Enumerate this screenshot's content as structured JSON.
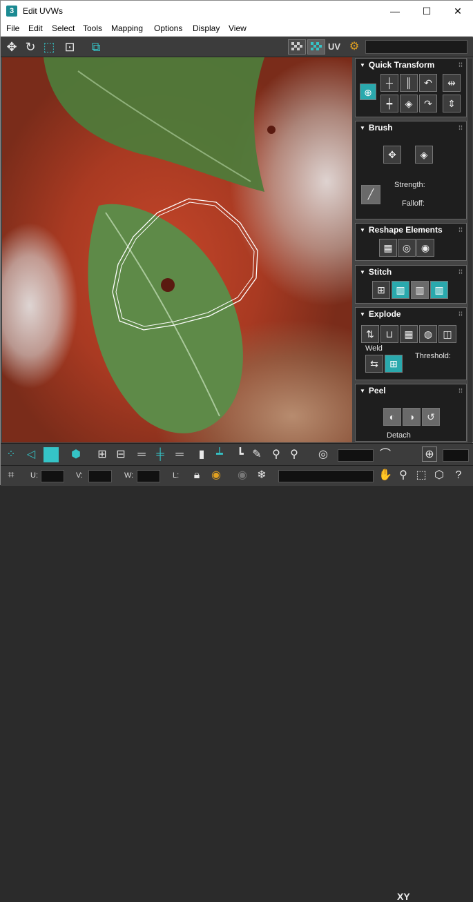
{
  "window": {
    "app_icon": "3",
    "title": "Edit UVWs",
    "minimize_glyph": "—",
    "maximize_glyph": "☐",
    "close_glyph": "✕"
  },
  "menu": [
    "File",
    "Edit",
    "Select",
    "Tools",
    "Mapping",
    "Options",
    "Display",
    "View"
  ],
  "toolbar": {
    "uv_label": "UV",
    "icons": [
      "move-icon",
      "rotate-icon",
      "scale-icon",
      "freeform-icon",
      "mirror-icon",
      "checker-pattern-icon",
      "checker-texture-icon",
      "uv-settings-icon"
    ]
  },
  "rollouts": {
    "quick_transform": {
      "title": "Quick Transform"
    },
    "brush": {
      "title": "Brush",
      "strength_label": "Strength:",
      "falloff_label": "Falloff:"
    },
    "reshape": {
      "title": "Reshape Elements"
    },
    "stitch": {
      "title": "Stitch"
    },
    "explode": {
      "title": "Explode",
      "weld_label": "Weld",
      "threshold_label": "Threshold:"
    },
    "peel": {
      "title": "Peel",
      "detach_label": "Detach"
    }
  },
  "bottom": {
    "xy_label": "XY",
    "u_label": "U:",
    "v_label": "V:",
    "w_label": "W:",
    "l_label": "L:"
  },
  "colors": {
    "accent": "#35c4c7",
    "panel_bg": "#1e1e1e",
    "toolbar_bg": "#3c3c3c"
  }
}
